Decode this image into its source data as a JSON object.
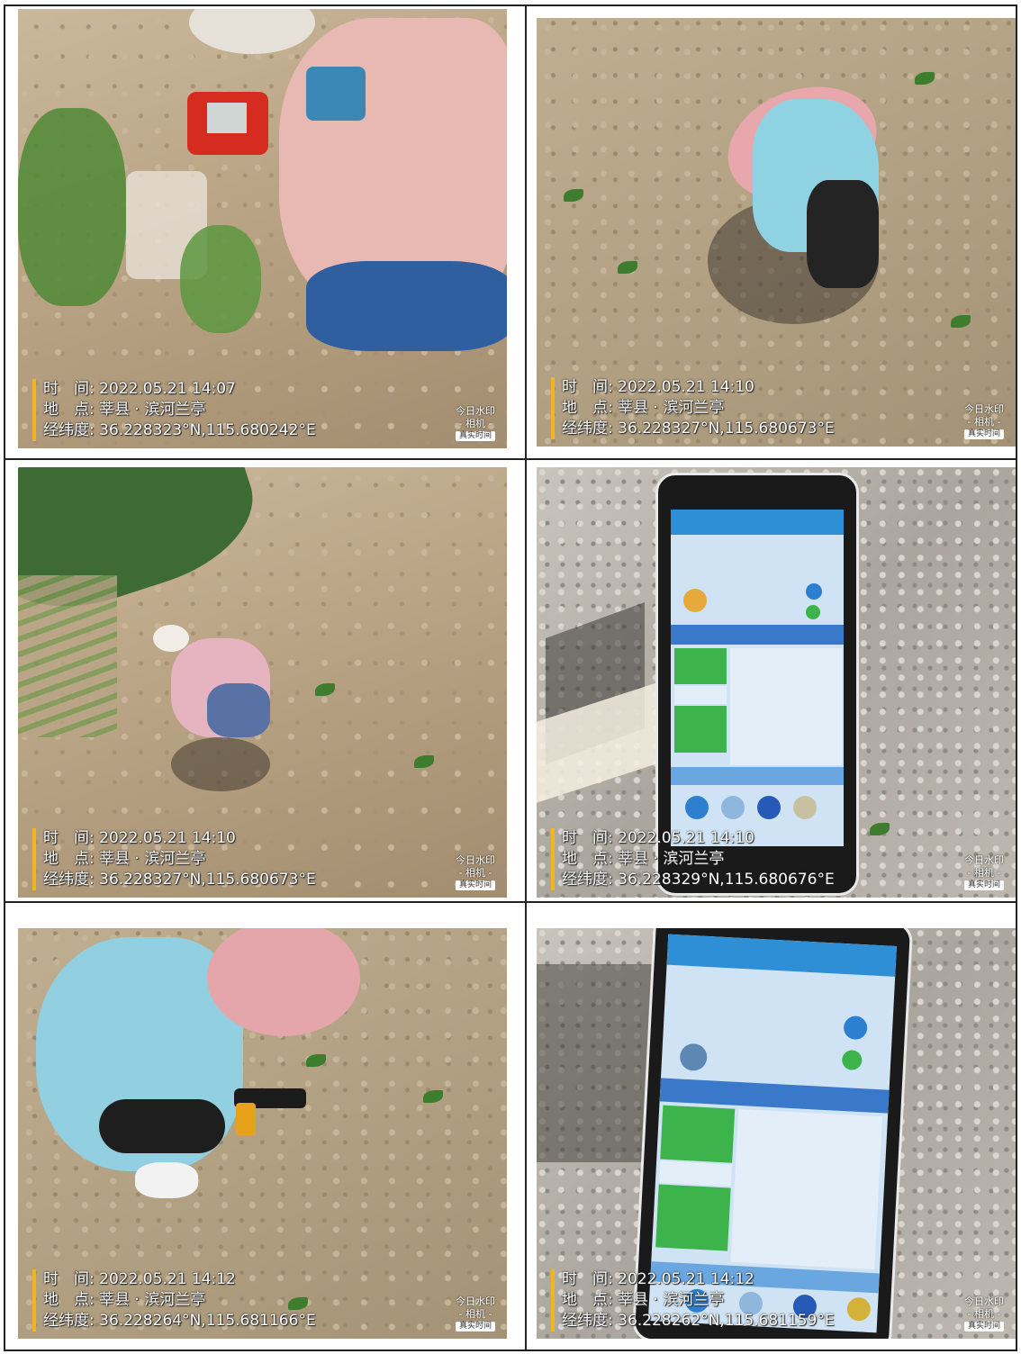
{
  "photos": [
    {
      "time_label": "时　间:",
      "time_value": "2022.05.21 14:07",
      "place_label": "地　点:",
      "place_value": "莘县 · 滨河兰亭",
      "coord_label": "经纬度:",
      "coord_value": "36.228323°N,115.680242°E",
      "brand_line1": "今日水印",
      "brand_line2": "- 相机 -",
      "brand_badge": "真实时间"
    },
    {
      "time_label": "时　间:",
      "time_value": "2022.05.21 14:10",
      "place_label": "地　点:",
      "place_value": "莘县 · 滨河兰亭",
      "coord_label": "经纬度:",
      "coord_value": "36.228327°N,115.680673°E",
      "brand_line1": "今日水印",
      "brand_line2": "- 相机 -",
      "brand_badge": "真实时间"
    },
    {
      "time_label": "时　间:",
      "time_value": "2022.05.21 14:10",
      "place_label": "地　点:",
      "place_value": "莘县 · 滨河兰亭",
      "coord_label": "经纬度:",
      "coord_value": "36.228327°N,115.680673°E",
      "brand_line1": "今日水印",
      "brand_line2": "- 相机 -",
      "brand_badge": "真实时间"
    },
    {
      "time_label": "时　间:",
      "time_value": "2022.05.21 14:10",
      "place_label": "地　点:",
      "place_value": "莘县 · 滨河兰亭",
      "coord_label": "经纬度:",
      "coord_value": "36.228329°N,115.680676°E",
      "brand_line1": "今日水印",
      "brand_line2": "- 相机 -",
      "brand_badge": "真实时间"
    },
    {
      "time_label": "时　间:",
      "time_value": "2022.05.21 14:12",
      "place_label": "地　点:",
      "place_value": "莘县 · 滨河兰亭",
      "coord_label": "经纬度:",
      "coord_value": "36.228264°N,115.681166°E",
      "brand_line1": "今日水印",
      "brand_line2": "- 相机 -",
      "brand_badge": "真实时间"
    },
    {
      "time_label": "时　间:",
      "time_value": "2022.05.21 14:12",
      "place_label": "地　点:",
      "place_value": "莘县 · 滨河兰亭",
      "coord_label": "经纬度:",
      "coord_value": "36.228262°N,115.681159°E",
      "brand_line1": "今日水印",
      "brand_line2": "- 相机 -",
      "brand_badge": "真实时间"
    }
  ],
  "colors": {
    "watermark_accent": "#f2b51a",
    "phone_screen_header": "#2f8fd6",
    "phone_green_cell": "#3cb44b"
  }
}
